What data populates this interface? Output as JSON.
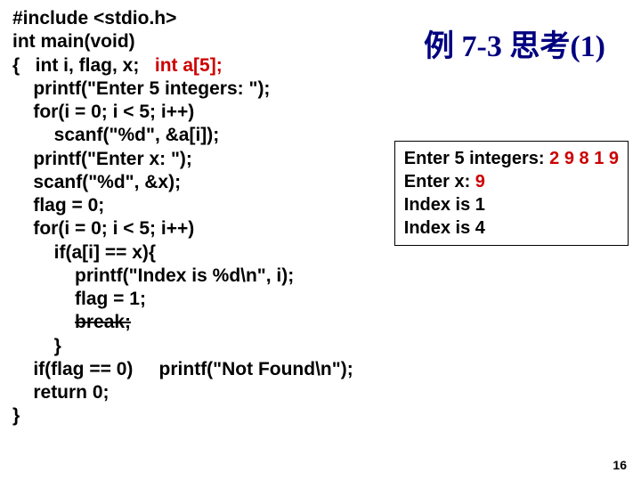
{
  "title": "例 7-3 思考(1)",
  "code": {
    "l1": "#include <stdio.h>",
    "l2": "int main(void)",
    "l3a": "{   int i, flag, x;   ",
    "l3b": "int a[5];",
    "l4": "    printf(\"Enter 5 integers: \");",
    "l5": "    for(i = 0; i < 5; i++)",
    "l6": "        scanf(\"%d\", &a[i]);",
    "l7": "    printf(\"Enter x: \");",
    "l8": "    scanf(\"%d\", &x);",
    "l9": "    flag = 0;",
    "l10": "    for(i = 0; i < 5; i++)",
    "l11": "        if(a[i] == x){",
    "l12": "            printf(\"Index is %d\\n\", i);",
    "l13": "            flag = 1;",
    "l14a": "            ",
    "l14b": "break;",
    "l15": "        }",
    "l16": "    if(flag == 0)     printf(\"Not Found\\n\");",
    "l17": "    return 0;",
    "l18": "}"
  },
  "output": {
    "l1a": "Enter 5 integers: ",
    "l1b": "2 9 8 1 9",
    "l2a": "Enter x: ",
    "l2b": "9",
    "l3": "Index is 1",
    "l4": "Index is 4"
  },
  "pagenum": "16"
}
